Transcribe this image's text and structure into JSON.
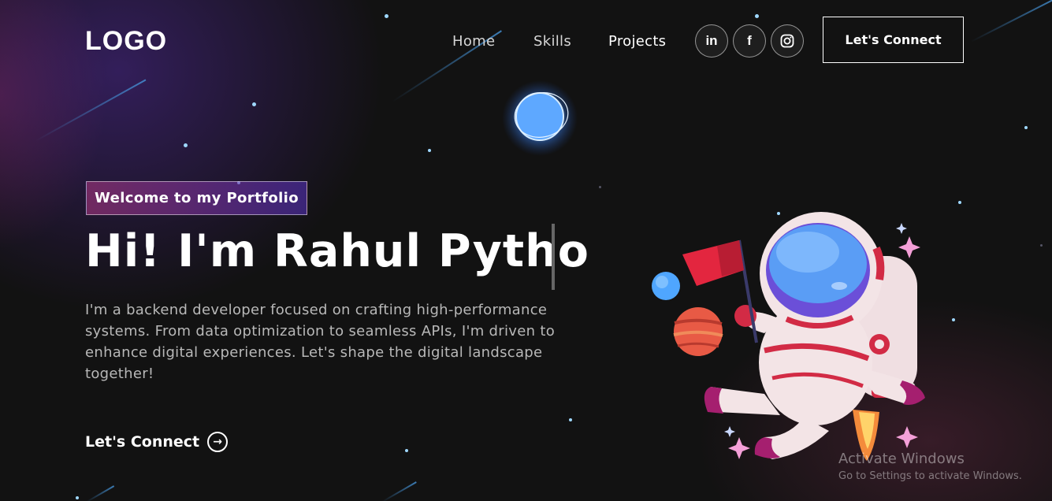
{
  "header": {
    "logo": "LOGO",
    "nav": [
      {
        "label": "Home",
        "active": false
      },
      {
        "label": "Skills",
        "active": false
      },
      {
        "label": "Projects",
        "active": true
      }
    ],
    "social": [
      {
        "icon": "linkedin-icon",
        "glyph": "in"
      },
      {
        "icon": "facebook-icon",
        "glyph": "f"
      },
      {
        "icon": "instagram-icon",
        "glyph": ""
      }
    ],
    "connect_label": "Let's Connect"
  },
  "hero": {
    "tagline": "Welcome to my Portfolio",
    "headline": "Hi! I'm Rahul Pytho",
    "description": "I'm a backend developer focused on crafting high-performance systems. From data optimization to seamless APIs, I'm driven to enhance digital experiences. Let's shape the digital landscape together!",
    "cta_label": "Let's Connect",
    "cta_icon": "arrow-right-circle-icon"
  },
  "illustration": {
    "subject": "astronaut-with-flag-illustration",
    "accent_colors": [
      "#e3263f",
      "#7b4ef0",
      "#4ea0ff",
      "#f4a0c8"
    ]
  },
  "watermark": {
    "line1": "Activate Windows",
    "line2": "Go to Settings to activate Windows."
  },
  "colors": {
    "background": "#121212",
    "tag_gradient_start": "#aa367c",
    "tag_gradient_end": "#4a2fbd",
    "text_muted": "#b8b8b8"
  }
}
